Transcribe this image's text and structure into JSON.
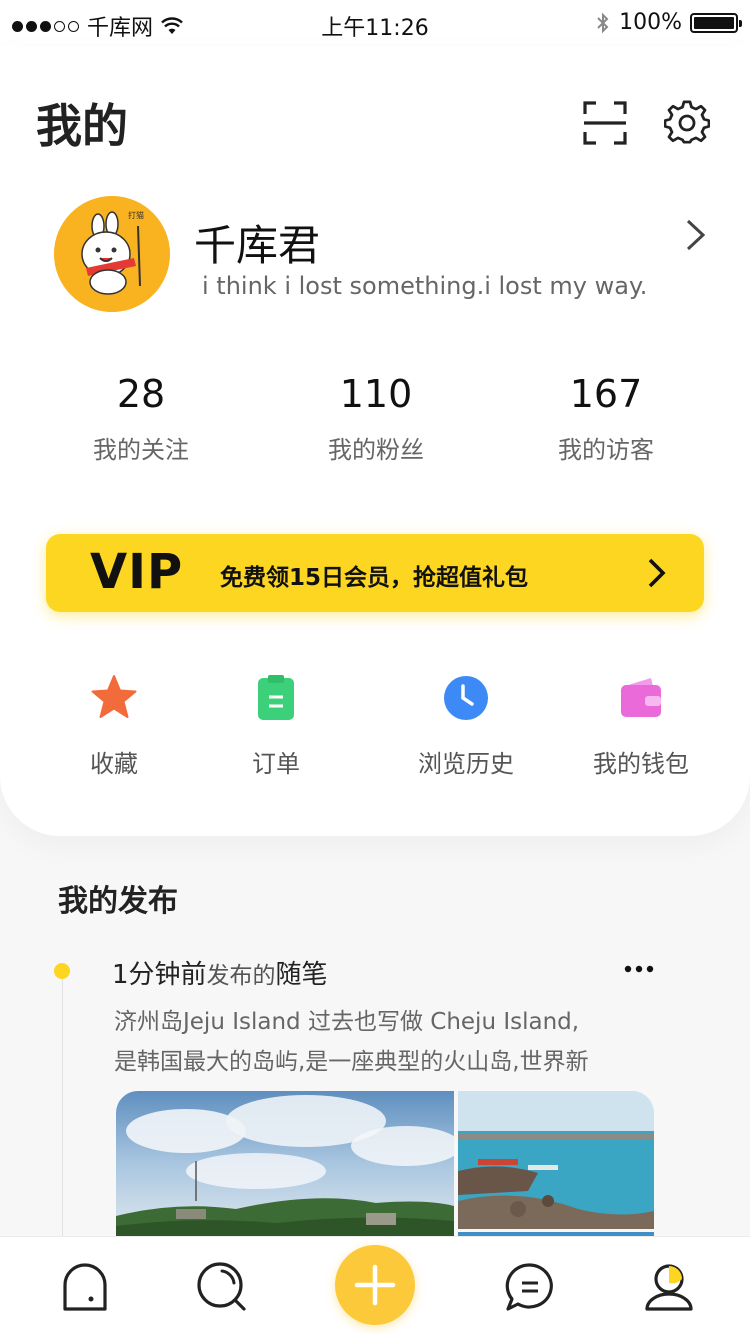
{
  "status_bar": {
    "carrier": "千库网",
    "time": "上午11:26",
    "battery": "100%"
  },
  "header": {
    "title": "我的"
  },
  "profile": {
    "avatar_badge": "打猫",
    "name": "千库君",
    "bio": "i think i lost something.i lost my way."
  },
  "stats": [
    {
      "value": "28",
      "label": "我的关注"
    },
    {
      "value": "110",
      "label": "我的粉丝"
    },
    {
      "value": "167",
      "label": "我的访客"
    }
  ],
  "vip": {
    "label": "VIP",
    "text": "免费领15日会员，抢超值礼包"
  },
  "quick_actions": [
    {
      "label": "收藏",
      "icon": "star-icon",
      "color": "#f26b3a"
    },
    {
      "label": "订单",
      "icon": "clipboard-icon",
      "color": "#3dd07a"
    },
    {
      "label": "浏览历史",
      "icon": "clock-icon",
      "color": "#3d8af7"
    },
    {
      "label": "我的钱包",
      "icon": "wallet-icon",
      "color": "#e96ad8"
    }
  ],
  "posts_section": {
    "title": "我的发布"
  },
  "post": {
    "time": "1分钟前",
    "verb": "发布的",
    "type": "随笔",
    "text_line1": "济州岛Jeju Island 过去也写做 Cheju Island,",
    "text_line2": "是韩国最大的岛屿,是一座典型的火山岛,世界新"
  },
  "tabbar": {
    "items": [
      "home-icon",
      "discover-icon",
      "add-icon",
      "message-icon",
      "profile-icon"
    ]
  },
  "colors": {
    "accent": "#fcd620",
    "add_button": "#fcc93a"
  }
}
